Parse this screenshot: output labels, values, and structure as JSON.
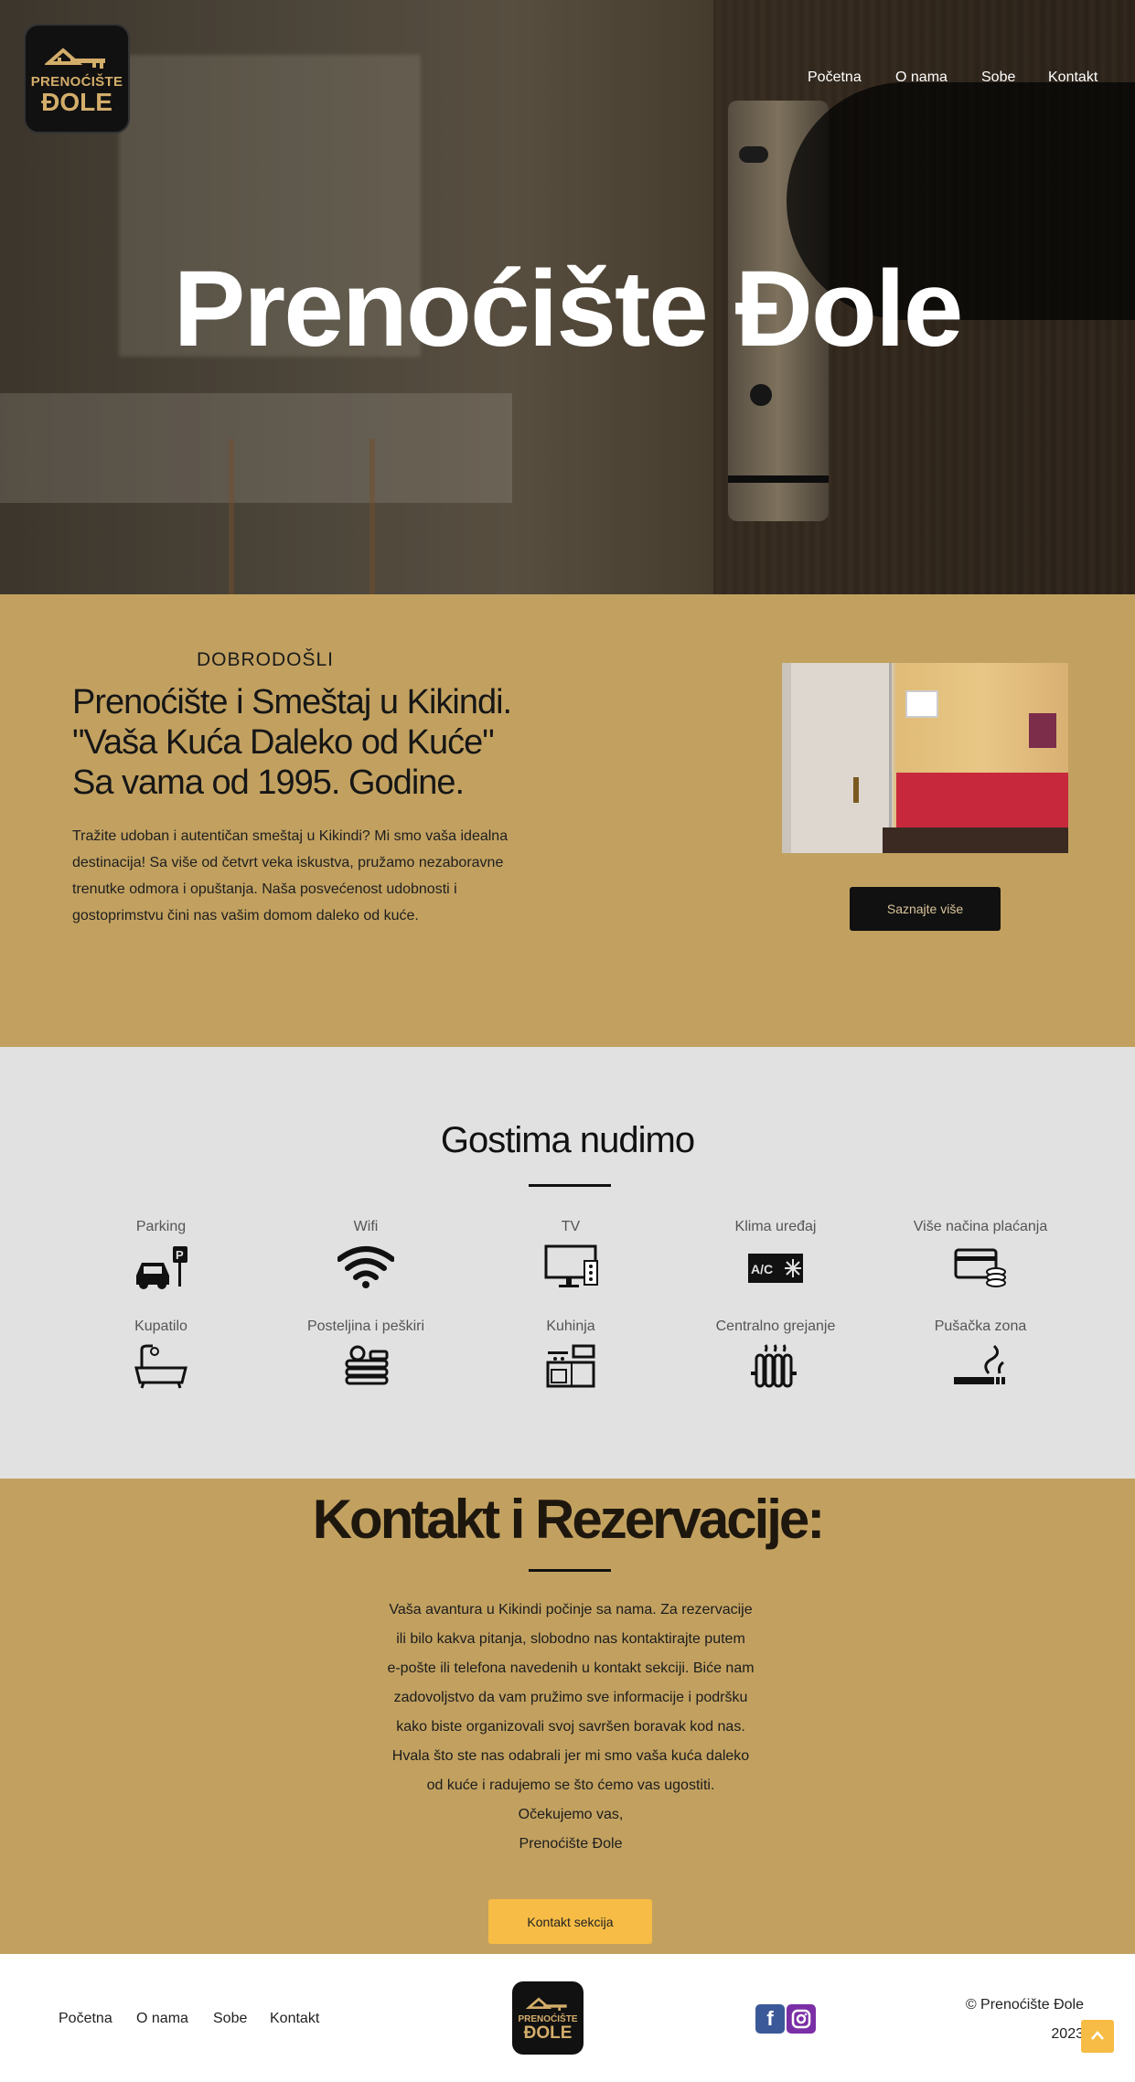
{
  "brand": {
    "logo_line1": "PRENOĆIŠTE",
    "logo_line2": "ĐOLE"
  },
  "nav": {
    "items": [
      "Početna",
      "O nama",
      "Sobe",
      "Kontakt"
    ]
  },
  "hero": {
    "title": "Prenoćište Đole"
  },
  "welcome": {
    "kicker": "DOBRODOŠLI",
    "heading_lines": [
      "Prenoćište i Smeštaj u Kikindi.",
      "\"Vaša Kuća Daleko od Kuće\"",
      "Sa vama od 1995. Godine."
    ],
    "body": "Tražite udoban i autentičan smeštaj u Kikindi? Mi smo vaša idealna destinacija! Sa više od četvrt veka iskustva, pružamo nezaboravne trenutke odmora i opuštanja. Naša posvećenost udobnosti i gostoprimstvu čini nas vašim domom daleko od kuće.",
    "button": "Saznajte više"
  },
  "services": {
    "title": "Gostima nudimo",
    "items": [
      {
        "label": "Parking",
        "icon": "parking-car-icon"
      },
      {
        "label": "Wifi",
        "icon": "wifi-icon"
      },
      {
        "label": "TV",
        "icon": "tv-icon"
      },
      {
        "label": "Klima uređaj",
        "icon": "air-conditioner-icon"
      },
      {
        "label": "Više načina plaćanja",
        "icon": "payment-card-icon"
      },
      {
        "label": "Kupatilo",
        "icon": "bathtub-icon"
      },
      {
        "label": "Posteljina i peškiri",
        "icon": "towels-icon"
      },
      {
        "label": "Kuhinja",
        "icon": "kitchen-icon"
      },
      {
        "label": "Centralno grejanje",
        "icon": "radiator-icon"
      },
      {
        "label": "Pušačka zona",
        "icon": "smoking-icon"
      }
    ],
    "ac_badge": "A/C"
  },
  "contact": {
    "title": "Kontakt i Rezervacije:",
    "lines": [
      "Vaša avantura u Kikindi počinje sa nama. Za rezervacije",
      "ili bilo kakva pitanja, slobodno nas kontaktirajte putem",
      "e-pošte ili telefona navedenih u kontakt sekciji. Biće nam",
      "zadovoljstvo  da vam pružimo sve informacije i podršku",
      "kako biste organizovali svoj savršen boravak kod nas.",
      "Hvala što ste nas odabrali jer mi smo vaša kuća daleko",
      "od kuće i radujemo se što ćemo vas ugostiti.",
      "Očekujemo vas,",
      "Prenoćište Đole"
    ],
    "button": "Kontakt sekcija"
  },
  "footer": {
    "nav": [
      "Početna",
      "O nama",
      "Sobe",
      "Kontakt"
    ],
    "copyright_line1": "© Prenoćište Đole",
    "copyright_line2": "2023",
    "social": [
      "facebook-icon",
      "instagram-icon"
    ]
  },
  "colors": {
    "gold": "#c2a160",
    "button_gold": "#f7bc45",
    "dark": "#111111",
    "light_gray": "#e1e1e1"
  }
}
